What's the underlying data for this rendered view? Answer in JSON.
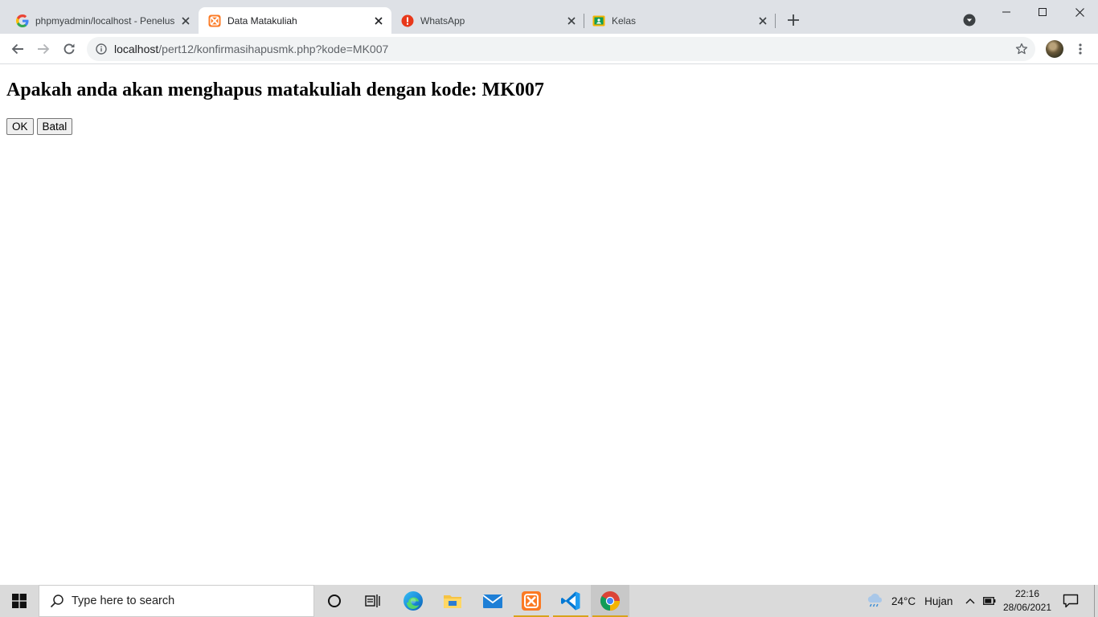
{
  "browser": {
    "tabs": [
      {
        "title": "phpmyadmin/localhost - Penelusuran Google",
        "favicon": "google-icon",
        "active": false
      },
      {
        "title": "Data Matakuliah",
        "favicon": "xampp-icon",
        "active": true
      },
      {
        "title": "WhatsApp",
        "favicon": "alert-icon",
        "active": false
      },
      {
        "title": "Kelas",
        "favicon": "google-classroom-icon",
        "active": false
      }
    ],
    "address": {
      "host": "localhost",
      "path": "/pert12/konfirmasihapusmk.php?kode=MK007"
    }
  },
  "page": {
    "heading": "Apakah anda akan menghapus matakuliah dengan kode: MK007",
    "ok_label": "OK",
    "cancel_label": "Batal"
  },
  "taskbar": {
    "search_placeholder": "Type here to search",
    "pinned": [
      "cortana-icon",
      "task-view-icon",
      "edge-icon",
      "file-explorer-icon",
      "mail-icon",
      "xampp-icon",
      "vscode-icon",
      "chrome-icon"
    ],
    "weather": {
      "temperature": "24°C",
      "condition": "Hujan"
    },
    "clock": {
      "time": "22:16",
      "date": "28/06/2021"
    }
  },
  "colors": {
    "tabstrip": "#dee1e6",
    "taskbar": "#dadada",
    "accent_underline": "#d8a31b",
    "xampp_orange": "#fb7a24"
  }
}
